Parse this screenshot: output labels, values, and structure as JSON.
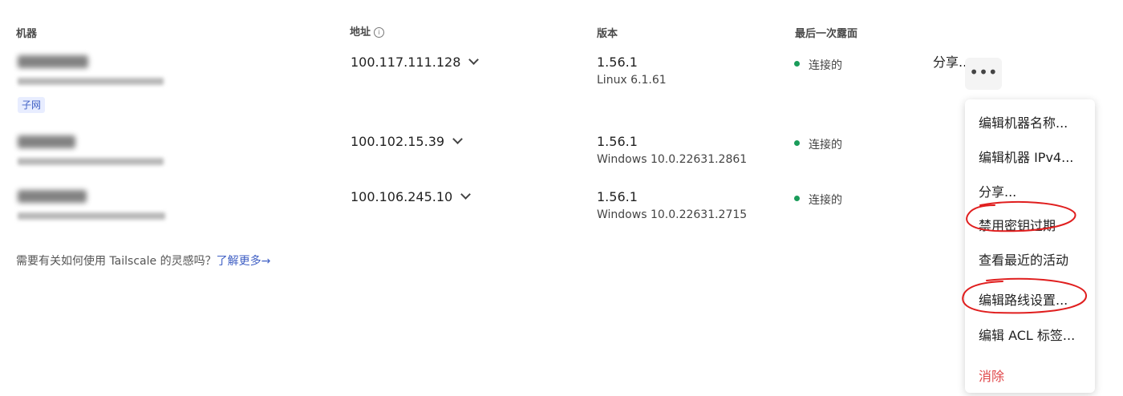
{
  "headers": {
    "machine": "机器",
    "address": "地址",
    "version": "版本",
    "last_seen": "最后一次露面"
  },
  "address_info_icon": "info-circle-icon",
  "machines": [
    {
      "address": "100.117.111.128",
      "version": "1.56.1",
      "os": "Linux 6.1.61",
      "status": "连接的",
      "badge": "子网"
    },
    {
      "address": "100.102.15.39",
      "version": "1.56.1",
      "os": "Windows 10.0.22631.2861",
      "status": "连接的"
    },
    {
      "address": "100.106.245.10",
      "version": "1.56.1",
      "os": "Windows 10.0.22631.2715",
      "status": "连接的"
    }
  ],
  "row_actions": {
    "share_label": "分享...",
    "more_icon": "more-horizontal-icon"
  },
  "menu": [
    {
      "label": "编辑机器名称..."
    },
    {
      "label": "编辑机器 IPv4..."
    },
    {
      "label": "分享..."
    },
    {
      "label": "禁用密钥过期"
    },
    {
      "label": "查看最近的活动"
    },
    {
      "label": "编辑路线设置..."
    },
    {
      "label": "编辑 ACL 标签..."
    },
    {
      "label": "消除",
      "danger": true
    }
  ],
  "footer": {
    "text": "需要有关如何使用 Tailscale 的灵感吗？",
    "link": "了解更多→"
  },
  "colors": {
    "status_connected": "#1a9c5a",
    "link": "#3f5fc4",
    "danger": "#e0474a",
    "annotation": "#e01e1e"
  }
}
